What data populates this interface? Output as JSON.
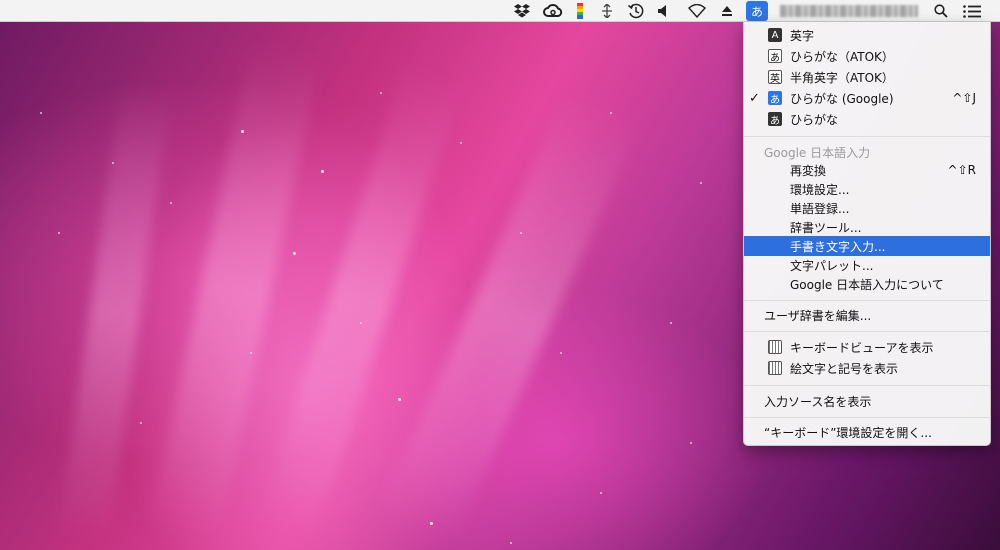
{
  "menubar": {
    "ime_indicator": "あ",
    "icons": [
      "dropbox-icon",
      "creative-cloud-icon",
      "color-bar-icon",
      "network-arrows-icon",
      "time-machine-icon",
      "volume-icon",
      "wifi-icon",
      "eject-icon",
      "spotlight-search-icon",
      "notification-list-icon"
    ]
  },
  "menu": {
    "input_sources": [
      {
        "badge": "A",
        "label": "英字",
        "style": "dark",
        "checked": false,
        "shortcut": ""
      },
      {
        "badge": "あ",
        "label": "ひらがな（ATOK）",
        "style": "outline",
        "checked": false,
        "shortcut": ""
      },
      {
        "badge": "英",
        "label": "半角英字（ATOK）",
        "style": "outline",
        "checked": false,
        "shortcut": ""
      },
      {
        "badge": "あ",
        "label": "ひらがな (Google)",
        "style": "blue",
        "checked": true,
        "shortcut": "^⇧J"
      },
      {
        "badge": "あ",
        "label": "ひらがな",
        "style": "dark",
        "checked": false,
        "shortcut": ""
      }
    ],
    "check_mark": "✓",
    "google_header": "Google 日本語入力",
    "google_items": [
      {
        "label": "再変換",
        "shortcut": "^⇧R"
      },
      {
        "label": "環境設定...",
        "shortcut": ""
      },
      {
        "label": "単語登録...",
        "shortcut": ""
      },
      {
        "label": "辞書ツール...",
        "shortcut": ""
      },
      {
        "label": "手書き文字入力...",
        "shortcut": ""
      },
      {
        "label": "文字パレット...",
        "shortcut": ""
      },
      {
        "label": "Google 日本語入力について",
        "shortcut": ""
      }
    ],
    "edit_user_dict": "ユーザ辞書を編集...",
    "show_keyboard_viewer": "キーボードビューアを表示",
    "show_emoji": "絵文字と記号を表示",
    "show_source_name": "入力ソース名を表示",
    "open_keyboard_prefs": "“キーボード”環境設定を開く..."
  },
  "colors": {
    "highlight": "#2e6fde",
    "menubar": "#f3f3f3"
  }
}
